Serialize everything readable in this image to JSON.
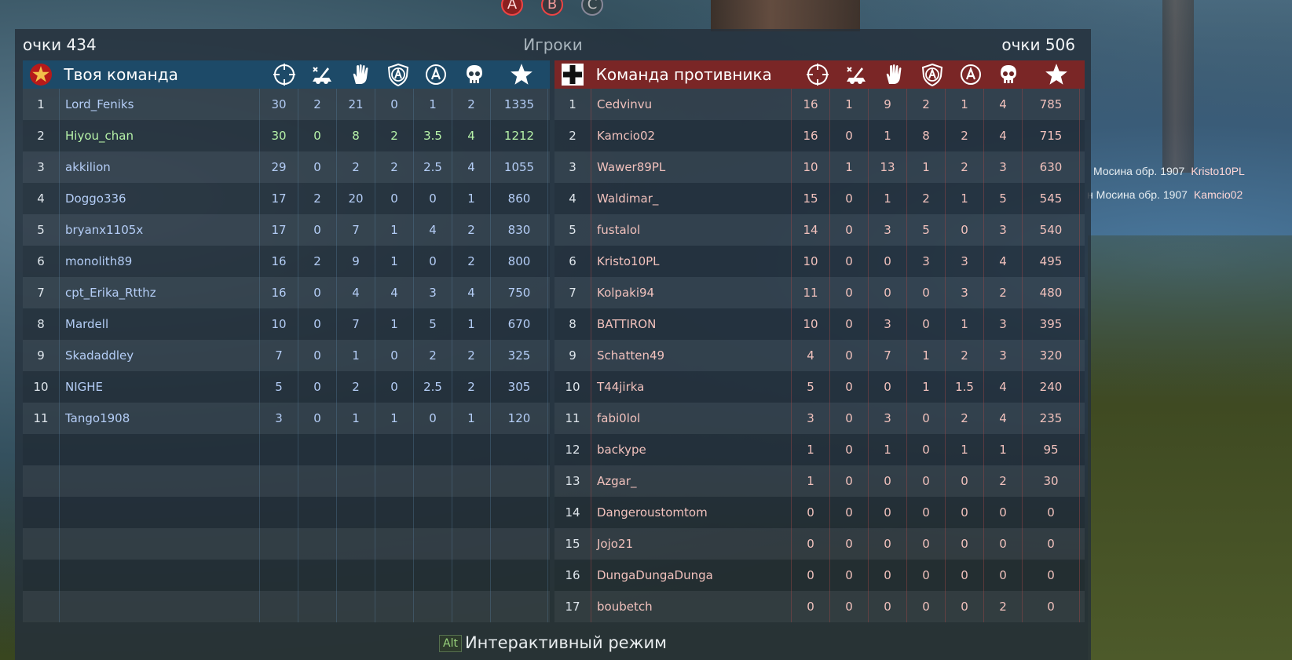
{
  "capture_points": [
    "A",
    "B",
    "C"
  ],
  "killfeed": [
    {
      "weapon": "Мосина обр. 1907",
      "victim": "Kristo10PL"
    },
    {
      "weapon": "н Мосина обр. 1907",
      "victim": "Kamcio02"
    }
  ],
  "scoreboard": {
    "title": "Игроки",
    "ally_score_label": "очки 434",
    "enemy_score_label": "очки 506",
    "ally_team_name": "Твоя команда",
    "enemy_team_name": "Команда противника",
    "column_icons": [
      "crosshair-icon",
      "artillery-icon",
      "hand-icon",
      "shield-a-icon",
      "circle-a-icon",
      "skull-icon",
      "star-icon"
    ],
    "colors": {
      "ally_header": "#1d4a68",
      "enemy_header": "#7a2626",
      "ally_text": "#b4cdf6",
      "highlight_text": "#b6f2a8",
      "enemy_text": "#f2c2bd"
    },
    "ally_players": [
      {
        "num": "1",
        "name": "Lord_Feniks",
        "stats": [
          "30",
          "2",
          "21",
          "0",
          "1",
          "2",
          "1335"
        ]
      },
      {
        "num": "2",
        "name": "Hiyou_chan",
        "stats": [
          "30",
          "0",
          "8",
          "2",
          "3.5",
          "4",
          "1212"
        ]
      },
      {
        "num": "3",
        "name": "akkilion",
        "stats": [
          "29",
          "0",
          "2",
          "2",
          "2.5",
          "4",
          "1055"
        ]
      },
      {
        "num": "4",
        "name": "Doggo336",
        "stats": [
          "17",
          "2",
          "20",
          "0",
          "0",
          "1",
          "860"
        ]
      },
      {
        "num": "5",
        "name": "bryanx1105x",
        "stats": [
          "17",
          "0",
          "7",
          "1",
          "4",
          "2",
          "830"
        ]
      },
      {
        "num": "6",
        "name": "monolith89",
        "stats": [
          "16",
          "2",
          "9",
          "1",
          "0",
          "2",
          "800"
        ]
      },
      {
        "num": "7",
        "name": "cpt_Erika_Rtthz",
        "stats": [
          "16",
          "0",
          "4",
          "4",
          "3",
          "4",
          "750"
        ]
      },
      {
        "num": "8",
        "name": "Mardell",
        "stats": [
          "10",
          "0",
          "7",
          "1",
          "5",
          "1",
          "670"
        ]
      },
      {
        "num": "9",
        "name": "Skadaddley",
        "stats": [
          "7",
          "0",
          "1",
          "0",
          "2",
          "2",
          "325"
        ]
      },
      {
        "num": "10",
        "name": "NIGHE",
        "stats": [
          "5",
          "0",
          "2",
          "0",
          "2.5",
          "2",
          "305"
        ]
      },
      {
        "num": "11",
        "name": "Tango1908",
        "stats": [
          "3",
          "0",
          "1",
          "1",
          "0",
          "1",
          "120"
        ]
      }
    ],
    "enemy_players": [
      {
        "num": "1",
        "name": "Cedvinvu",
        "stats": [
          "16",
          "1",
          "9",
          "2",
          "1",
          "4",
          "785"
        ]
      },
      {
        "num": "2",
        "name": "Kamcio02",
        "stats": [
          "16",
          "0",
          "1",
          "8",
          "2",
          "4",
          "715"
        ]
      },
      {
        "num": "3",
        "name": "Wawer89PL",
        "stats": [
          "10",
          "1",
          "13",
          "1",
          "2",
          "3",
          "630"
        ]
      },
      {
        "num": "4",
        "name": "Waldimar_",
        "stats": [
          "15",
          "0",
          "1",
          "2",
          "1",
          "5",
          "545"
        ]
      },
      {
        "num": "5",
        "name": "fustalol",
        "stats": [
          "14",
          "0",
          "3",
          "5",
          "0",
          "3",
          "540"
        ]
      },
      {
        "num": "6",
        "name": "Kristo10PL",
        "stats": [
          "10",
          "0",
          "0",
          "3",
          "3",
          "4",
          "495"
        ]
      },
      {
        "num": "7",
        "name": "Kolpaki94",
        "stats": [
          "11",
          "0",
          "0",
          "0",
          "3",
          "2",
          "480"
        ]
      },
      {
        "num": "8",
        "name": "BATTIRON",
        "stats": [
          "10",
          "0",
          "3",
          "0",
          "1",
          "3",
          "395"
        ]
      },
      {
        "num": "9",
        "name": "Schatten49",
        "stats": [
          "4",
          "0",
          "7",
          "1",
          "2",
          "3",
          "320"
        ]
      },
      {
        "num": "10",
        "name": "T44jirka",
        "stats": [
          "5",
          "0",
          "0",
          "1",
          "1.5",
          "4",
          "240"
        ]
      },
      {
        "num": "11",
        "name": "fabi0lol",
        "stats": [
          "3",
          "0",
          "3",
          "0",
          "2",
          "4",
          "235"
        ]
      },
      {
        "num": "12",
        "name": "backype",
        "stats": [
          "1",
          "0",
          "1",
          "0",
          "1",
          "1",
          "95"
        ]
      },
      {
        "num": "13",
        "name": "Azgar_",
        "stats": [
          "1",
          "0",
          "0",
          "0",
          "0",
          "2",
          "30"
        ]
      },
      {
        "num": "14",
        "name": "Dangeroustomtom",
        "stats": [
          "0",
          "0",
          "0",
          "0",
          "0",
          "0",
          "0"
        ]
      },
      {
        "num": "15",
        "name": "Jojo21",
        "stats": [
          "0",
          "0",
          "0",
          "0",
          "0",
          "0",
          "0"
        ]
      },
      {
        "num": "16",
        "name": "DungaDungaDunga",
        "stats": [
          "0",
          "0",
          "0",
          "0",
          "0",
          "0",
          "0"
        ]
      },
      {
        "num": "17",
        "name": "boubetch",
        "stats": [
          "0",
          "0",
          "0",
          "0",
          "0",
          "2",
          "0"
        ]
      }
    ],
    "highlight_player_index": 1,
    "footer_key": "Alt",
    "footer_label": "Интерактивный режим"
  }
}
